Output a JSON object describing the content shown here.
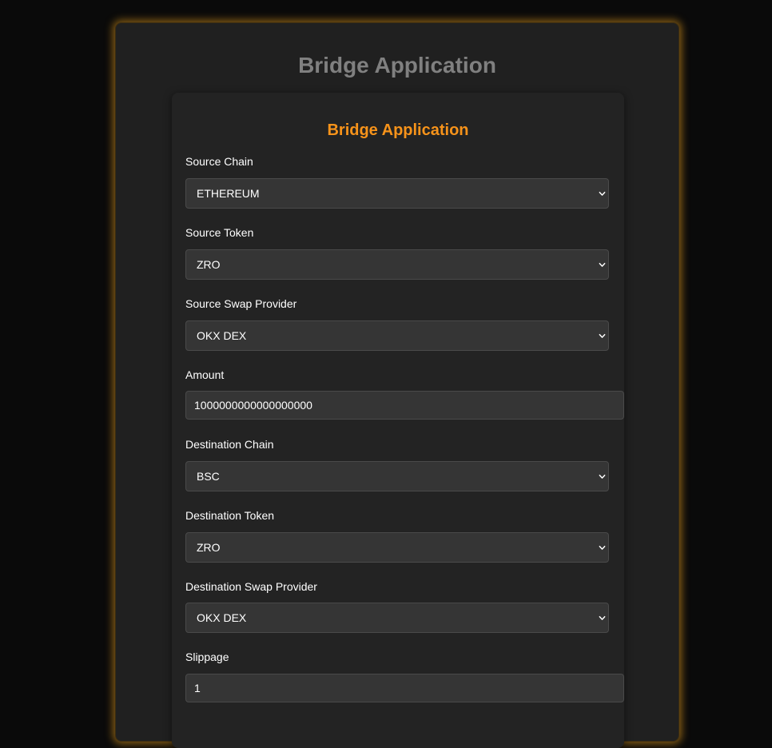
{
  "page": {
    "title": "Bridge Application"
  },
  "form": {
    "title": "Bridge Application",
    "source_chain": {
      "label": "Source Chain",
      "value": "ETHEREUM"
    },
    "source_token": {
      "label": "Source Token",
      "value": "ZRO"
    },
    "source_swap_provider": {
      "label": "Source Swap Provider",
      "value": "OKX DEX"
    },
    "amount": {
      "label": "Amount",
      "value": "1000000000000000000"
    },
    "destination_chain": {
      "label": "Destination Chain",
      "value": "BSC"
    },
    "destination_token": {
      "label": "Destination Token",
      "value": "ZRO"
    },
    "destination_swap_provider": {
      "label": "Destination Swap Provider",
      "value": "OKX DEX"
    },
    "slippage": {
      "label": "Slippage",
      "value": "1"
    }
  },
  "icons": {
    "dropdown": "chevron-down-icon"
  },
  "colors": {
    "accent": "#f7931a",
    "glow": "#eba01e",
    "background": "#0a0a0a",
    "panel": "#202020",
    "field": "#353535"
  }
}
